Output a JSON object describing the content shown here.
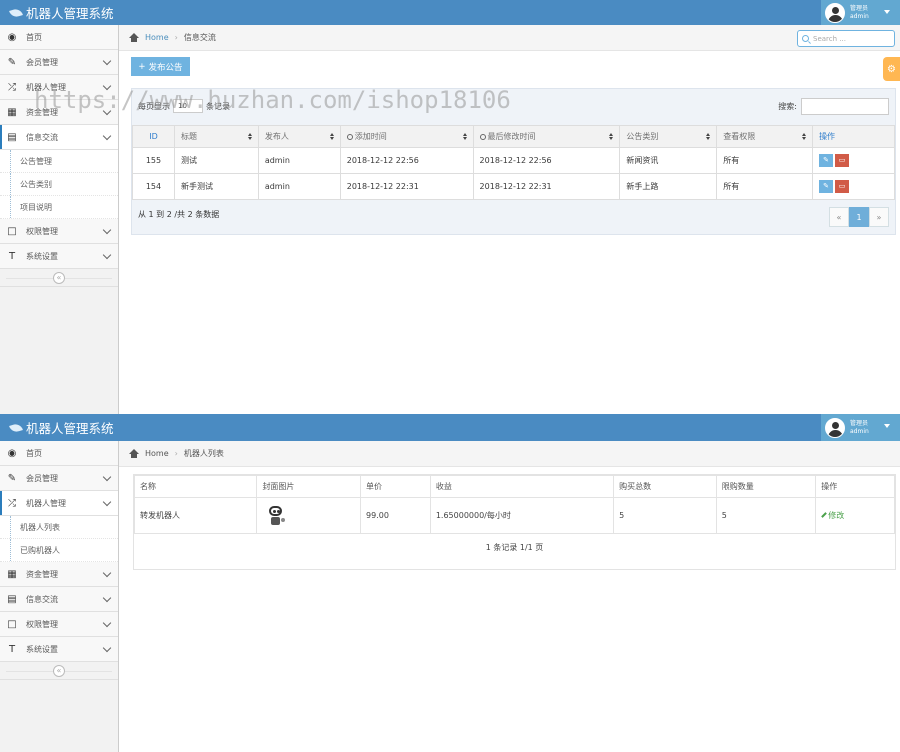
{
  "watermark": "https://www.huzhan.com/ishop18106",
  "panel1": {
    "app_title": "机器人管理系统",
    "user": {
      "role": "管理员",
      "name": "admin"
    },
    "sidebar": {
      "items": [
        {
          "label": "首页",
          "icon": "dashboard-icon"
        },
        {
          "label": "会员管理",
          "icon": "edit-icon"
        },
        {
          "label": "机器人管理",
          "icon": "shuffle-icon"
        },
        {
          "label": "资金管理",
          "icon": "calendar-icon"
        },
        {
          "label": "信息交流",
          "icon": "list-icon"
        },
        {
          "label": "权限管理",
          "icon": "file-icon"
        },
        {
          "label": "系统设置",
          "icon": "text-icon"
        }
      ],
      "subitems": [
        "公告管理",
        "公告类别",
        "项目说明"
      ]
    },
    "breadcrumb": {
      "home": "Home",
      "current": "信息交流"
    },
    "search_placeholder": "Search ...",
    "add_button": "发布公告",
    "table_controls": {
      "show_prefix": "每页显示",
      "show_value": "10",
      "show_suffix": "条记录",
      "search_label": "搜索:"
    },
    "table": {
      "headers": [
        "ID",
        "标题",
        "发布人",
        "添加时间",
        "最后修改时间",
        "公告类别",
        "查看权限",
        "操作"
      ],
      "rows": [
        {
          "id": "155",
          "title": "测试",
          "publisher": "admin",
          "added": "2018-12-12 22:56",
          "modified": "2018-12-12 22:56",
          "category": "新闻资讯",
          "permission": "所有"
        },
        {
          "id": "154",
          "title": "新手测试",
          "publisher": "admin",
          "added": "2018-12-12 22:31",
          "modified": "2018-12-12 22:31",
          "category": "新手上路",
          "permission": "所有"
        }
      ]
    },
    "table_info": "从 1 到 2 /共 2 条数据",
    "pager": [
      "«",
      "1",
      "»"
    ]
  },
  "panel2": {
    "app_title": "机器人管理系统",
    "user": {
      "role": "管理员",
      "name": "admin"
    },
    "sidebar": {
      "items": [
        {
          "label": "首页",
          "icon": "dashboard-icon"
        },
        {
          "label": "会员管理",
          "icon": "edit-icon"
        },
        {
          "label": "机器人管理",
          "icon": "shuffle-icon"
        },
        {
          "label": "资金管理",
          "icon": "calendar-icon"
        },
        {
          "label": "信息交流",
          "icon": "list-icon"
        },
        {
          "label": "权限管理",
          "icon": "file-icon"
        },
        {
          "label": "系统设置",
          "icon": "text-icon"
        }
      ],
      "subitems": [
        "机器人列表",
        "已购机器人"
      ]
    },
    "breadcrumb": {
      "home": "Home",
      "current": "机器人列表"
    },
    "table": {
      "headers": [
        "名称",
        "封面图片",
        "单价",
        "收益",
        "购买总数",
        "限购数量",
        "操作"
      ],
      "rows": [
        {
          "name": "转发机器人",
          "price": "99.00",
          "income": "1.65000000/每小时",
          "total": "5",
          "limit": "5",
          "action": "修改"
        }
      ]
    },
    "table_info": "1 条记录 1/1 页"
  },
  "colors": {
    "navbar": "#4a8bc2",
    "accent": "#6fb3e0",
    "danger": "#d15b47",
    "warning": "#ffb752",
    "success": "#4ba14b"
  }
}
